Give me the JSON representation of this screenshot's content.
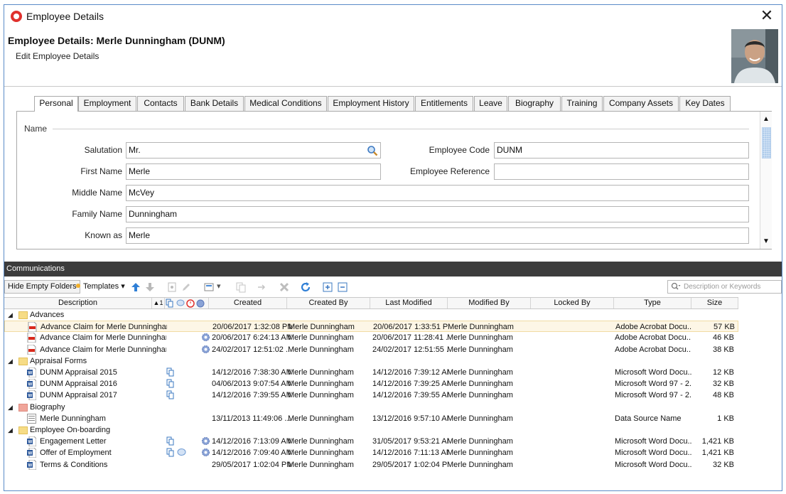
{
  "window": {
    "title": "Employee Details"
  },
  "header": {
    "title": "Employee Details: Merle Dunningham (DUNM)",
    "subtitle": "Edit Employee Details"
  },
  "tabs": [
    {
      "label": "Personal",
      "active": true
    },
    {
      "label": "Employment"
    },
    {
      "label": "Contacts"
    },
    {
      "label": "Bank Details"
    },
    {
      "label": "Medical Conditions"
    },
    {
      "label": "Employment History"
    },
    {
      "label": "Entitlements"
    },
    {
      "label": "Leave"
    },
    {
      "label": "Biography"
    },
    {
      "label": "Training"
    },
    {
      "label": "Company Assets"
    },
    {
      "label": "Key Dates"
    }
  ],
  "name_group": {
    "label": "Name",
    "fields": {
      "salutation": {
        "label": "Salutation",
        "value": "Mr."
      },
      "first_name": {
        "label": "First Name",
        "value": "Merle"
      },
      "middle_name": {
        "label": "Middle Name",
        "value": "McVey"
      },
      "family_name": {
        "label": "Family Name",
        "value": "Dunningham"
      },
      "known_as": {
        "label": "Known as",
        "value": "Merle"
      },
      "employee_code": {
        "label": "Employee Code",
        "value": "DUNM"
      },
      "employee_reference": {
        "label": "Employee Reference",
        "value": ""
      }
    }
  },
  "communications": {
    "title": "Communications",
    "toolbar": {
      "hide_empty": "Hide Empty Folders",
      "templates": "Templates",
      "search_placeholder": "Description or Keywords"
    },
    "columns": {
      "description": "Description",
      "sort": "▲1",
      "created": "Created",
      "created_by": "Created By",
      "last_modified": "Last Modified",
      "modified_by": "Modified By",
      "locked_by": "Locked By",
      "type": "Type",
      "size": "Size"
    },
    "rows": [
      {
        "kind": "folder",
        "name": "Advances",
        "color": "#f6dc86"
      },
      {
        "kind": "doc",
        "file": "pdf",
        "name": "Advance Claim for Merle Dunningham ...",
        "created": "20/06/2017 1:32:08 PM",
        "created_by": "Merle Dunningham",
        "modified": "20/06/2017 1:33:51 PM",
        "modified_by": "Merle Dunningham",
        "type": "Adobe Acrobat Docu...",
        "size": "57 KB",
        "selected": true
      },
      {
        "kind": "doc",
        "file": "pdf",
        "name": "Advance Claim for Merle Dunningham ...",
        "gear": true,
        "created": "20/06/2017 6:24:13 AM",
        "created_by": "Merle Dunningham",
        "modified": "20/06/2017 11:28:41 ...",
        "modified_by": "Merle Dunningham",
        "type": "Adobe Acrobat Docu...",
        "size": "46 KB"
      },
      {
        "kind": "doc",
        "file": "pdf",
        "name": "Advance Claim for Merle Dunningham ...",
        "gear": true,
        "created": "24/02/2017 12:51:02 ...",
        "created_by": "Merle Dunningham",
        "modified": "24/02/2017 12:51:55 ...",
        "modified_by": "Merle Dunningham",
        "type": "Adobe Acrobat Docu...",
        "size": "38 KB"
      },
      {
        "kind": "folder",
        "name": "Appraisal Forms",
        "color": "#f6dc86"
      },
      {
        "kind": "doc",
        "file": "word",
        "name": "DUNM Appraisal 2015",
        "copy": true,
        "created": "14/12/2016 7:38:30 AM",
        "created_by": "Merle Dunningham",
        "modified": "14/12/2016 7:39:12 AM",
        "modified_by": "Merle Dunningham",
        "type": "Microsoft Word Docu...",
        "size": "12 KB"
      },
      {
        "kind": "doc",
        "file": "word",
        "name": "DUNM Appraisal 2016",
        "copy": true,
        "created": "04/06/2013 9:07:54 AM",
        "created_by": "Merle Dunningham",
        "modified": "14/12/2016 7:39:25 AM",
        "modified_by": "Merle Dunningham",
        "type": "Microsoft Word 97 - 2...",
        "size": "32 KB"
      },
      {
        "kind": "doc",
        "file": "word",
        "name": "DUNM Appraisal 2017",
        "copy": true,
        "created": "14/12/2016 7:39:55 AM",
        "created_by": "Merle Dunningham",
        "modified": "14/12/2016 7:39:55 AM",
        "modified_by": "Merle Dunningham",
        "type": "Microsoft Word 97 - 2...",
        "size": "48 KB"
      },
      {
        "kind": "folder",
        "name": "Biography",
        "color": "#f0a59a"
      },
      {
        "kind": "doc",
        "file": "data",
        "name": "Merle Dunningham",
        "created": "13/11/2013 11:49:06 ...",
        "created_by": "Merle Dunningham",
        "modified": "13/12/2016 9:57:10 AM",
        "modified_by": "Merle Dunningham",
        "type": "Data Source Name",
        "size": "1 KB"
      },
      {
        "kind": "folder",
        "name": "Employee On-boarding",
        "color": "#f6dc86"
      },
      {
        "kind": "doc",
        "file": "word",
        "name": "Engagement Letter",
        "copy": true,
        "gear": true,
        "created": "14/12/2016 7:13:09 AM",
        "created_by": "Merle Dunningham",
        "modified": "31/05/2017 9:53:21 AM",
        "modified_by": "Merle Dunningham",
        "type": "Microsoft Word Docu...",
        "size": "1,421 KB"
      },
      {
        "kind": "doc",
        "file": "word",
        "name": "Offer of Employment",
        "copy": true,
        "comment": true,
        "gear": true,
        "created": "14/12/2016 7:09:40 AM",
        "created_by": "Merle Dunningham",
        "modified": "14/12/2016 7:11:13 AM",
        "modified_by": "Merle Dunningham",
        "type": "Microsoft Word Docu...",
        "size": "1,421 KB"
      },
      {
        "kind": "doc",
        "file": "word",
        "name": "Terms & Conditions",
        "created": "29/05/2017 1:02:04 PM",
        "created_by": "Merle Dunningham",
        "modified": "29/05/2017 1:02:04 PM",
        "modified_by": "Merle Dunningham",
        "type": "Microsoft Word Docu...",
        "size": "32 KB"
      }
    ]
  },
  "colors": {
    "accent": "#e0312d",
    "comm_bar": "#3c3c3c",
    "selection": "#fdf6e6"
  },
  "icons": [
    "app-logo-icon",
    "close-icon",
    "lookup-icon",
    "up-arrow-icon",
    "down-arrow-icon",
    "refresh-icon",
    "expand-icon",
    "collapse-icon",
    "delete-icon"
  ]
}
